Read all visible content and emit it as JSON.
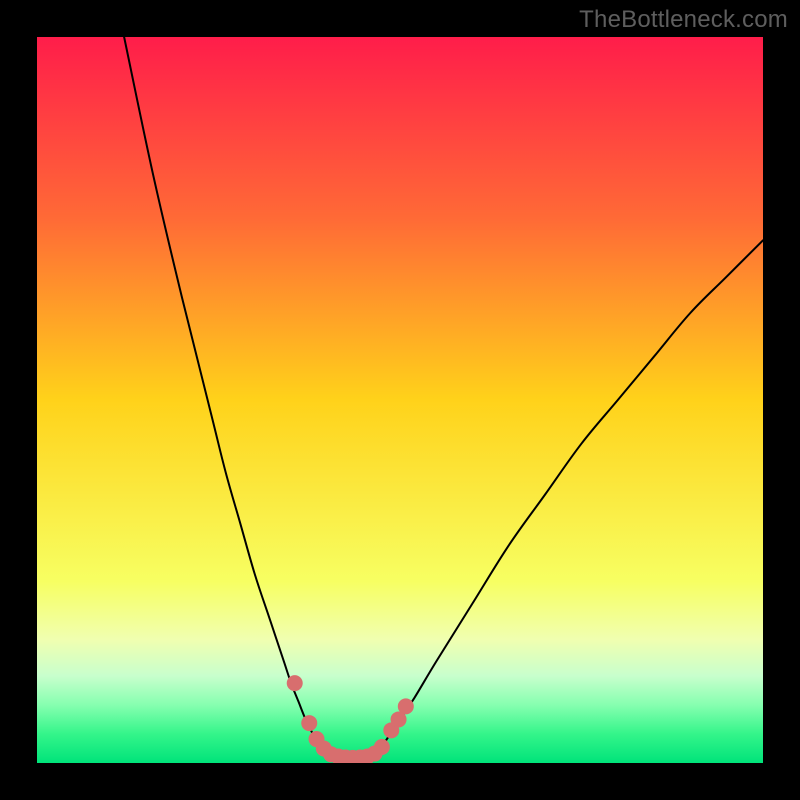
{
  "watermark": "TheBottleneck.com",
  "chart_data": {
    "type": "line",
    "title": "",
    "xlabel": "",
    "ylabel": "",
    "xlim": [
      0,
      100
    ],
    "ylim": [
      0,
      100
    ],
    "grid": false,
    "legend": false,
    "background_gradient": {
      "stops": [
        {
          "offset": 0,
          "color": "#ff1d4a"
        },
        {
          "offset": 25,
          "color": "#ff6a36"
        },
        {
          "offset": 50,
          "color": "#ffd21a"
        },
        {
          "offset": 75,
          "color": "#f7ff62"
        },
        {
          "offset": 83,
          "color": "#f0ffb0"
        },
        {
          "offset": 88,
          "color": "#c8ffcd"
        },
        {
          "offset": 92,
          "color": "#86ffb0"
        },
        {
          "offset": 96,
          "color": "#34f58a"
        },
        {
          "offset": 100,
          "color": "#00e37a"
        }
      ]
    },
    "series": [
      {
        "name": "left-curve",
        "x": [
          12,
          16,
          20,
          24,
          26,
          28,
          30,
          32,
          34,
          35,
          36,
          37,
          38,
          39,
          40
        ],
        "y": [
          100,
          81,
          64,
          48,
          40,
          33,
          26,
          20,
          14,
          11,
          8.5,
          6,
          4,
          2.5,
          1.5
        ]
      },
      {
        "name": "right-curve",
        "x": [
          47,
          48,
          50,
          52,
          55,
          60,
          65,
          70,
          75,
          80,
          85,
          90,
          95,
          100
        ],
        "y": [
          1.5,
          3,
          6,
          9,
          14,
          22,
          30,
          37,
          44,
          50,
          56,
          62,
          67,
          72
        ]
      },
      {
        "name": "valley-floor",
        "x": [
          40,
          41,
          42,
          43,
          44,
          45,
          46,
          47
        ],
        "y": [
          1.5,
          1,
          0.8,
          0.7,
          0.7,
          0.8,
          1,
          1.5
        ]
      }
    ],
    "annotations": {
      "dots": [
        {
          "x": 35.5,
          "y": 11.0
        },
        {
          "x": 37.5,
          "y": 5.5
        },
        {
          "x": 38.5,
          "y": 3.3
        },
        {
          "x": 39.5,
          "y": 2.0
        },
        {
          "x": 40.5,
          "y": 1.2
        },
        {
          "x": 41.5,
          "y": 0.9
        },
        {
          "x": 42.5,
          "y": 0.75
        },
        {
          "x": 43.5,
          "y": 0.7
        },
        {
          "x": 44.5,
          "y": 0.75
        },
        {
          "x": 45.5,
          "y": 0.9
        },
        {
          "x": 46.5,
          "y": 1.3
        },
        {
          "x": 47.5,
          "y": 2.2
        },
        {
          "x": 48.8,
          "y": 4.5
        },
        {
          "x": 49.8,
          "y": 6.0
        },
        {
          "x": 50.8,
          "y": 7.8
        }
      ],
      "dot_color": "#d86e6e",
      "dot_radius": 8
    }
  }
}
